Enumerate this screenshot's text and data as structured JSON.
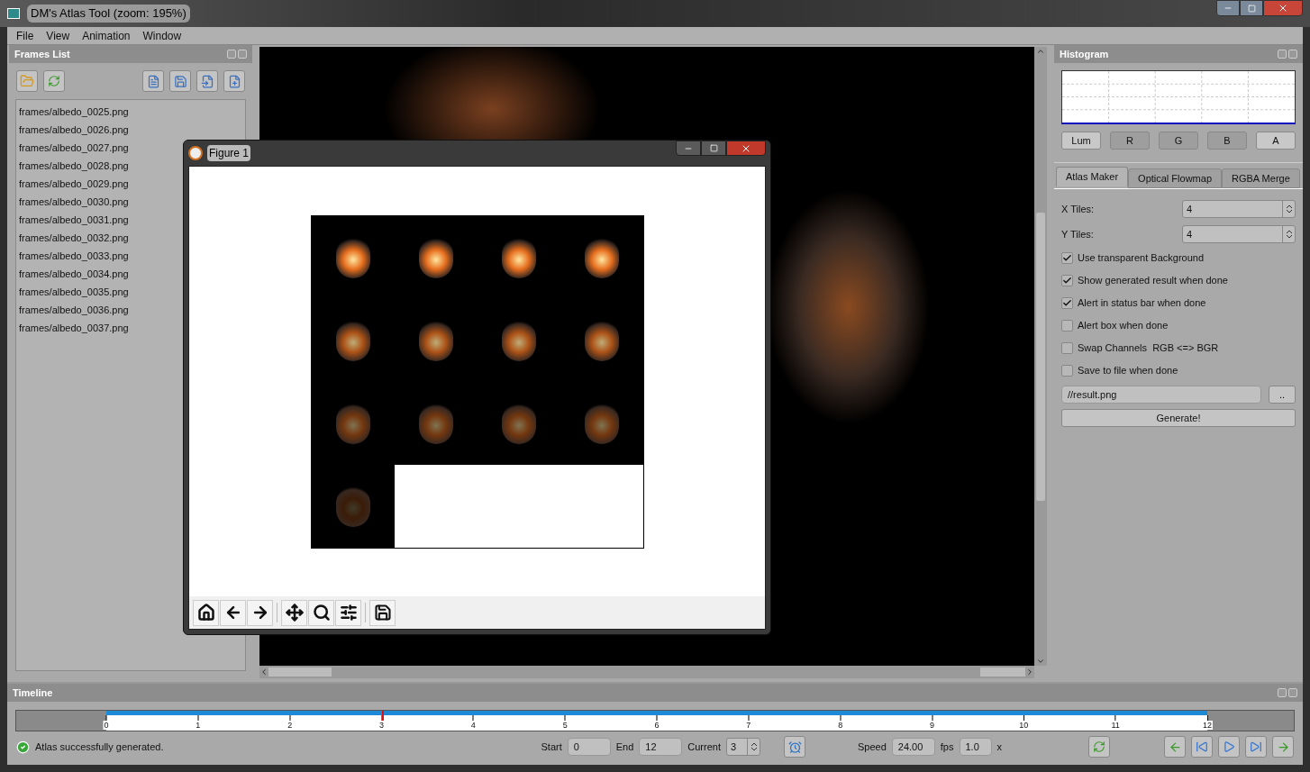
{
  "window": {
    "title": "DM's Atlas Tool (zoom: 195%)"
  },
  "menu": [
    "File",
    "View",
    "Animation",
    "Window"
  ],
  "frames_list": {
    "title": "Frames List",
    "items": [
      "frames/albedo_0025.png",
      "frames/albedo_0026.png",
      "frames/albedo_0027.png",
      "frames/albedo_0028.png",
      "frames/albedo_0029.png",
      "frames/albedo_0030.png",
      "frames/albedo_0031.png",
      "frames/albedo_0032.png",
      "frames/albedo_0033.png",
      "frames/albedo_0034.png",
      "frames/albedo_0035.png",
      "frames/albedo_0036.png",
      "frames/albedo_0037.png"
    ]
  },
  "figure": {
    "title": "Figure 1"
  },
  "histogram": {
    "title": "Histogram",
    "channels": [
      {
        "label": "Lum",
        "pressed": false
      },
      {
        "label": "R",
        "pressed": true
      },
      {
        "label": "G",
        "pressed": true
      },
      {
        "label": "B",
        "pressed": true
      },
      {
        "label": "A",
        "pressed": false
      }
    ]
  },
  "tabs": [
    {
      "label": "Atlas Maker",
      "selected": true
    },
    {
      "label": "Optical Flowmap",
      "selected": false
    },
    {
      "label": "RGBA Merge",
      "selected": false
    }
  ],
  "atlas": {
    "x_tiles": {
      "label": "X Tiles:",
      "value": "4"
    },
    "y_tiles": {
      "label": "Y Tiles:",
      "value": "4"
    },
    "options": [
      {
        "label": "Use transparent Background",
        "checked": true
      },
      {
        "label": "Show generated result when done",
        "checked": true
      },
      {
        "label": "Alert in status bar when done",
        "checked": true
      },
      {
        "label": "Alert box when done",
        "checked": false
      },
      {
        "label": "Swap Channels  RGB <=> BGR",
        "checked": false
      },
      {
        "label": "Save to file when done",
        "checked": false
      }
    ],
    "output_path": "//result.png",
    "browse": "..",
    "generate": "Generate!"
  },
  "timeline": {
    "title": "Timeline",
    "ticks": [
      "0",
      "1",
      "2",
      "3",
      "4",
      "5",
      "6",
      "7",
      "8",
      "9",
      "10",
      "11",
      "12"
    ],
    "playhead": {
      "level": 0.25
    },
    "status": "Atlas successfully generated.",
    "start": {
      "label": "Start",
      "value": "0"
    },
    "end": {
      "label": "End",
      "value": "12"
    },
    "current": {
      "label": "Current",
      "value": "3"
    },
    "speed": {
      "label": "Speed",
      "value": "24.00",
      "unit": "fps"
    },
    "multiplier": {
      "value": "1.0",
      "unit": "x"
    }
  }
}
